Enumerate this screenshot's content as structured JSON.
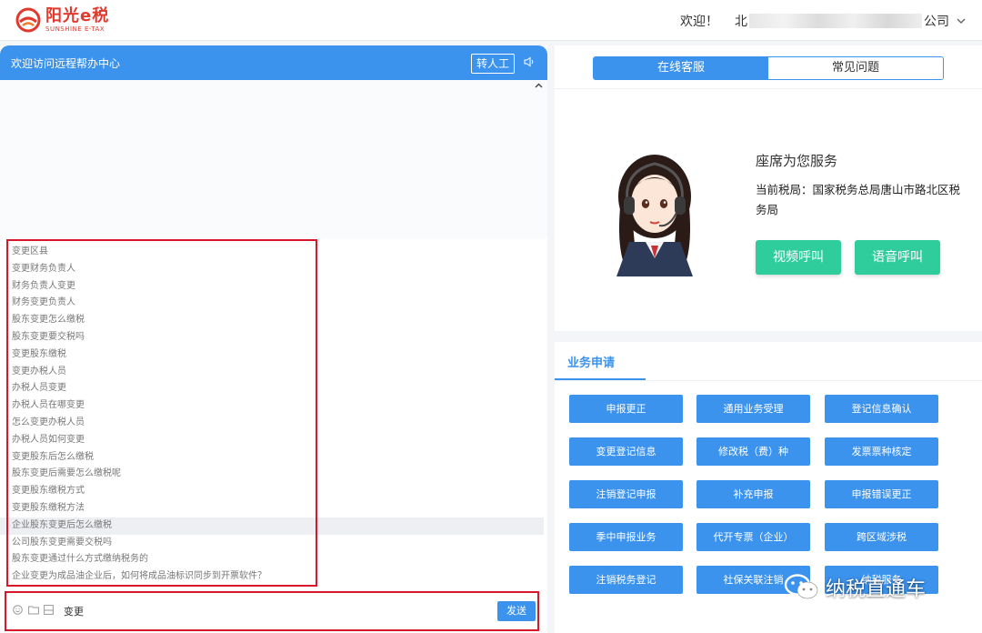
{
  "header": {
    "logo_cn": "阳光e税",
    "logo_en": "SUNSHINE E-TAX",
    "welcome": "欢迎！",
    "company_prefix": "北",
    "company_suffix": "公司",
    "colors": {
      "brand": "#e03a2f"
    }
  },
  "chat": {
    "title": "欢迎访问远程帮办中心",
    "to_human": "转人工",
    "suggestions": [
      "变更区县",
      "变更财务负责人",
      "财务负责人变更",
      "财务变更负责人",
      "股东变更怎么缴税",
      "股东变更要交税吗",
      "变更股东缴税",
      "变更办税人员",
      "办税人员变更",
      "办税人员在哪变更",
      "怎么变更办税人员",
      "办税人员如何变更",
      "变更股东后怎么缴税",
      "股东变更后需要怎么缴税呢",
      "变更股东缴税方式",
      "变更股东缴税方法",
      "企业股东变更后怎么缴税",
      "公司股东变更需要交税吗",
      "股东变更通过什么方式缴纳税务的",
      "企业变更为成品油企业后，如何将成品油标识同步到开票软件？"
    ],
    "active_index": 16,
    "input_value": "变更",
    "send_label": "发送",
    "colors": {
      "header": "#3b93ee"
    }
  },
  "service": {
    "tabs": [
      "在线客服",
      "常见问题"
    ],
    "active_tab": 0,
    "agent_title": "座席为您服务",
    "bureau": "当前税局：国家税务总局唐山市路北区税务局",
    "video_call": "视频呼叫",
    "voice_call": "语音呼叫",
    "colors": {
      "call": "#2fcc9c"
    }
  },
  "business": {
    "tab": "业务申请",
    "buttons": [
      "申报更正",
      "通用业务受理",
      "登记信息确认",
      "变更登记信息",
      "修改税（费）种",
      "发票票种核定",
      "注销登记申报",
      "补充申报",
      "申报错误更正",
      "季中申报业务",
      "代开专票（企业）",
      "跨区域涉税",
      "注销税务登记",
      "社保关联注销",
      "纳税服务"
    ]
  },
  "watermark": {
    "text": "纳税直通车",
    "icon": "wechat-icon"
  }
}
